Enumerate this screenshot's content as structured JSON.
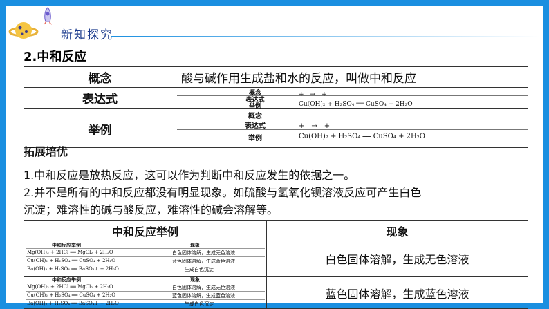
{
  "header": {
    "title": "新知探究"
  },
  "section_title": "2.中和反应",
  "table1": {
    "rows": [
      {
        "label": "概念",
        "value": "酸与碱作用生成盐和水的反应，叫做中和反应"
      },
      {
        "label": "表达式"
      },
      {
        "label": "举例"
      }
    ],
    "mini1": {
      "r1_label": "概念",
      "r2_label": "表达式",
      "r2_value": "+　→　+",
      "r3_label": "举例",
      "r3_value": "Cu(OH)₂ + H₂SO₄ ══ CuSO₄ + 2H₂O"
    },
    "mini2": {
      "r1_label": "概念",
      "r2_label": "表达式",
      "r2_value": "+　→　+",
      "r3_label": "举例",
      "r3_value": "Cu(OH)₂ + H₂SO₄ ══ CuSO₄ + 2H₂O"
    }
  },
  "extend": {
    "title": "拓展培优",
    "p1": "1.中和反应是放热反应，这可以作为判断中和反应发生的依据之一。",
    "p2": "2.并不是所有的中和反应都没有明显现象。如硫酸与氢氧化钡溶液反应可产生白色",
    "p3": "沉淀；难溶性的碱与酸反应，难溶性的碱会溶解等。"
  },
  "table2": {
    "head_left": "中和反应举例",
    "head_right": "现象",
    "observations": [
      "白色固体溶解，生成无色溶液",
      "蓝色固体溶解，生成蓝色溶液"
    ],
    "thumb1": {
      "h1": "中和反应举例",
      "h2": "现象",
      "e1": "Mg(OH)₂ + 2HCl ══ MgCl₂ + 2H₂O",
      "o1": "白色固体溶解，生成无色溶液",
      "e2": "Cu(OH)₂ + H₂SO₄ ══ CuSO₄ + 2H₂O",
      "o2": "蓝色固体溶解，生成蓝色溶液",
      "e3": "Ba(OH)₂ + H₂SO₄ ══ BaSO₄↓ + 2H₂O",
      "o3": "生成白色沉淀"
    },
    "thumb2": {
      "h1": "中和反应举例",
      "h2": "现象",
      "e1": "Mg(OH)₂ + 2HCl ══ MgCl₂ + 2H₂O",
      "o1": "白色固体溶解，生成无色溶液",
      "e2": "Cu(OH)₂ + H₂SO₄ ══ CuSO₄ + 2H₂O",
      "o2": "蓝色固体溶解，生成蓝色溶液",
      "e3": "Ba(OH)₂ + H₂SO₄ ══ BaSO₄↓ + 2H₂O",
      "o3": "生成白色沉淀"
    }
  },
  "colors": {
    "frame": "#1a8fe0",
    "title": "#1a3a8c"
  }
}
